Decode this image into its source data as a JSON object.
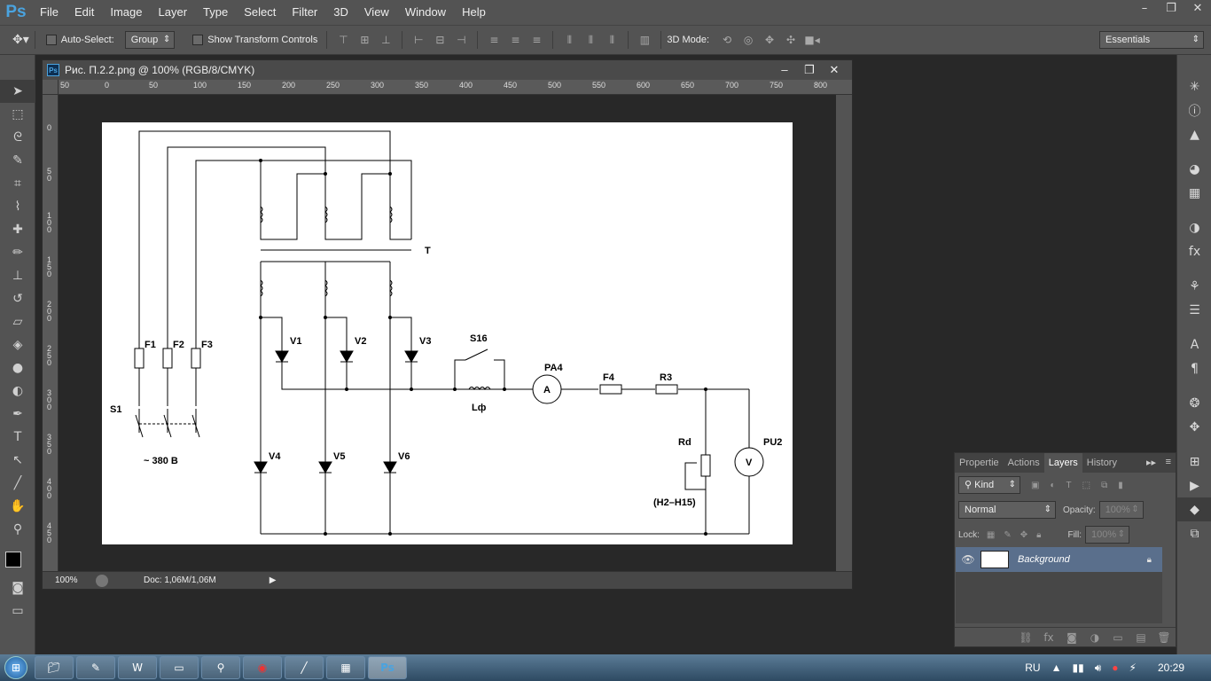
{
  "app": {
    "logo": "Ps"
  },
  "menu": [
    "File",
    "Edit",
    "Image",
    "Layer",
    "Type",
    "Select",
    "Filter",
    "3D",
    "View",
    "Window",
    "Help"
  ],
  "window_controls": [
    "–",
    "❐",
    "✕"
  ],
  "options": {
    "auto_select_label": "Auto-Select:",
    "group_value": "Group",
    "show_transform_label": "Show Transform Controls",
    "mode_3d_label": "3D Mode:",
    "workspace_value": "Essentials"
  },
  "document": {
    "title": "Рис. П.2.2.png @ 100% (RGB/8/CMYK)",
    "zoom": "100%",
    "doc_size": "Doc: 1,06M/1,06M",
    "ruler_h": [
      "50",
      "0",
      "50",
      "100",
      "150",
      "200",
      "250",
      "300",
      "350",
      "400",
      "450",
      "500",
      "550",
      "600",
      "650",
      "700",
      "750",
      "800"
    ],
    "ruler_v": [
      "0",
      "5\n0",
      "1\n0\n0",
      "1\n5\n0",
      "2\n0\n0",
      "2\n5\n0",
      "3\n0\n0",
      "3\n5\n0",
      "4\n0\n0",
      "4\n5\n0"
    ]
  },
  "schematic": {
    "T": "T",
    "F1": "F1",
    "F2": "F2",
    "F3": "F3",
    "S1": "S1",
    "supply": "~ 380 В",
    "V1": "V1",
    "V2": "V2",
    "V3": "V3",
    "V4": "V4",
    "V5": "V5",
    "V6": "V6",
    "S16": "S16",
    "Lf": "Lф",
    "PA4": "PA4",
    "A": "A",
    "F4": "F4",
    "R3": "R3",
    "Rd": "Rd",
    "range": "(H2–H15)",
    "PU2": "PU2",
    "Vm": "V"
  },
  "panel": {
    "tabs": [
      "Propertie",
      "Actions",
      "Layers",
      "History"
    ],
    "active_tab": "Layers",
    "kind_label": "Kind",
    "blend_mode": "Normal",
    "opacity_label": "Opacity:",
    "opacity_value": "100%",
    "lock_label": "Lock:",
    "fill_label": "Fill:",
    "fill_value": "100%",
    "layer_name": "Background"
  },
  "taskbar": {
    "lang": "RU",
    "time": "20:29"
  }
}
